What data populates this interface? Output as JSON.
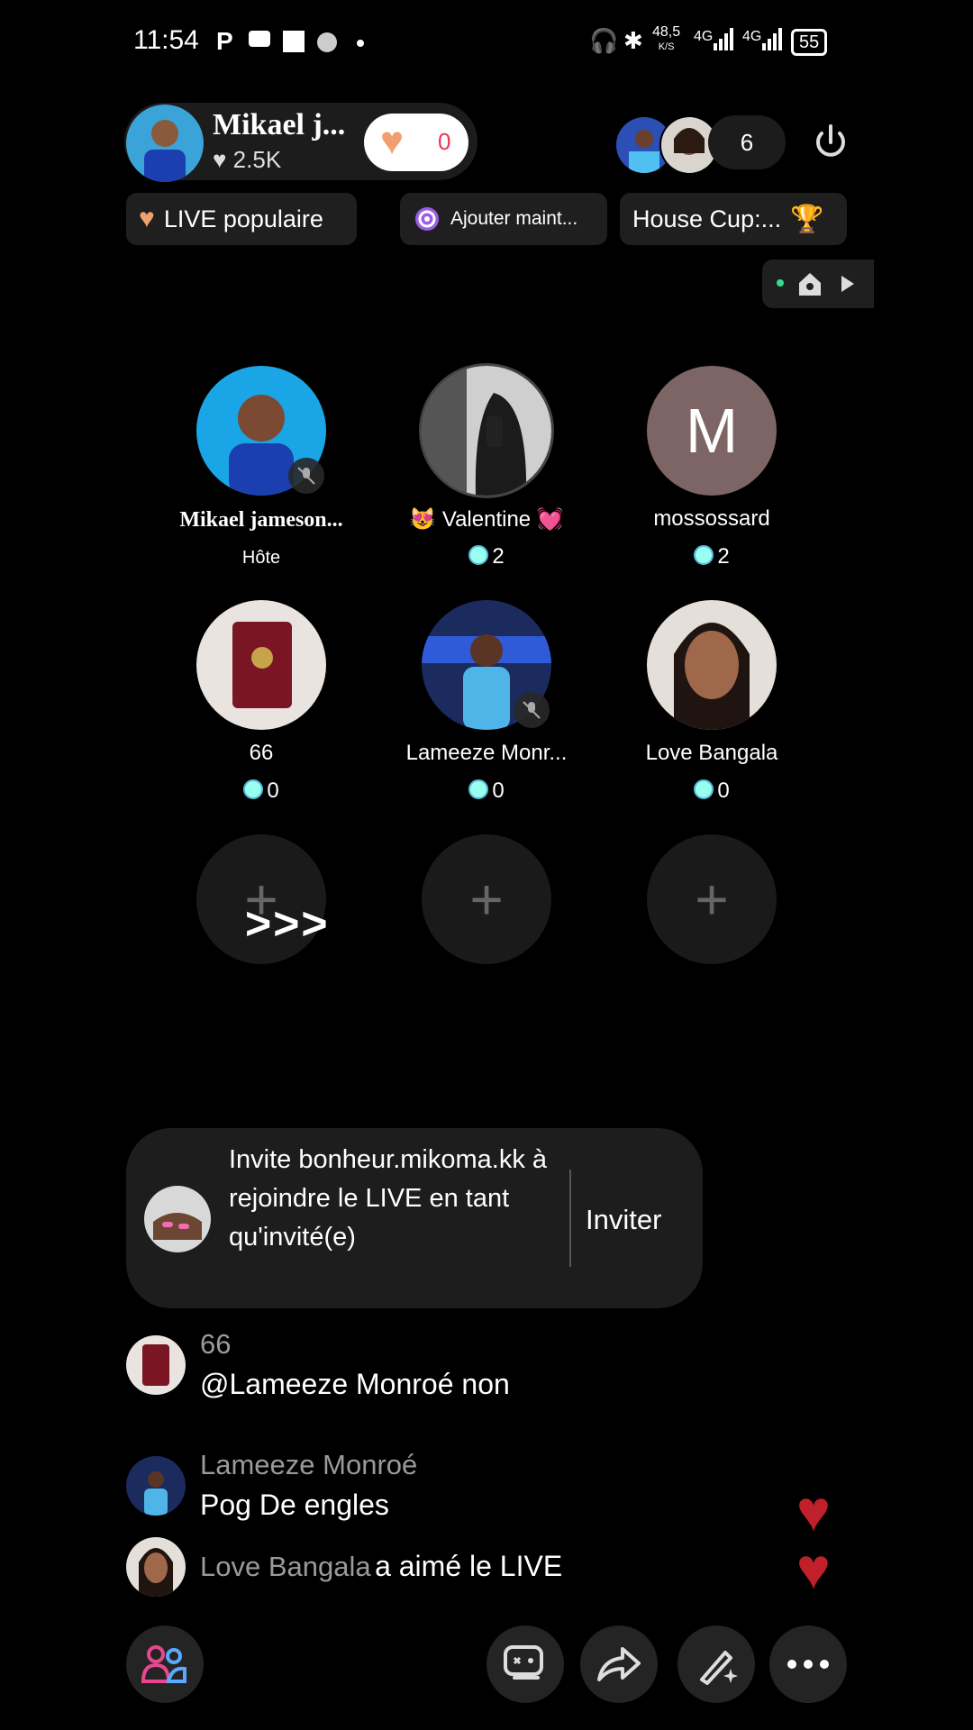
{
  "status_bar": {
    "time": "11:54",
    "speed": "48,5",
    "speed_unit": "K/S",
    "net1": "4G",
    "net2": "4G",
    "battery": "55"
  },
  "host": {
    "name": "Mikael j...",
    "likes": "2.5K",
    "heart_count": "0"
  },
  "viewers": {
    "count": "6"
  },
  "chips": {
    "live_popular": "LIVE populaire",
    "add_now": "Ajouter maint...",
    "house_cup": "House Cup:..."
  },
  "seats": [
    {
      "name": "Mikael jameson...",
      "sub": "Hôte"
    },
    {
      "name": "😻 Valentine 💓",
      "sub": "2"
    },
    {
      "name": "mossossard",
      "sub": "2",
      "initial": "M"
    },
    {
      "name": "66",
      "sub": "0"
    },
    {
      "name": "Lameeze Monr...",
      "sub": "0"
    },
    {
      "name": "Love Bangala",
      "sub": "0"
    }
  ],
  "empty_seat_symbol": "+",
  "overlay_arrows": ">>>",
  "invite": {
    "text": "Invite bonheur.mikoma.kk à rejoindre le LIVE en tant qu'invité(e)",
    "button": "Inviter"
  },
  "comments": [
    {
      "user": "66",
      "message": "@Lameeze Monroé non"
    },
    {
      "user": "Lameeze Monroé",
      "message": "Pog De engles"
    },
    {
      "user": "Love Bangala",
      "message": "a aimé le LIVE"
    }
  ],
  "colors": {
    "background": "#000000",
    "accent_heart": "#f0a070",
    "like_red": "#c0202a",
    "guests_icon": "#e8478f"
  }
}
